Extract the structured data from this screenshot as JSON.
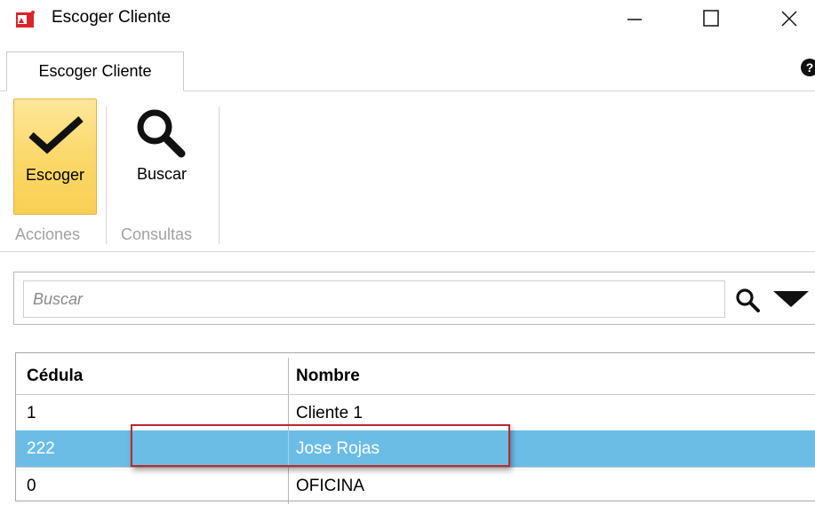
{
  "window": {
    "title": "Escoger Cliente"
  },
  "ribbon": {
    "tab_label": "Escoger Cliente",
    "groups": [
      {
        "label": "Acciones",
        "buttons": [
          {
            "label": "Escoger",
            "icon": "checkmark-icon",
            "active": true
          }
        ]
      },
      {
        "label": "Consultas",
        "buttons": [
          {
            "label": "Buscar",
            "icon": "search-icon",
            "active": false
          }
        ]
      }
    ]
  },
  "search": {
    "placeholder": "Buscar",
    "value": ""
  },
  "grid": {
    "columns": [
      "Cédula",
      "Nombre"
    ],
    "rows": [
      {
        "cedula": "1",
        "nombre": "Cliente 1",
        "selected": false
      },
      {
        "cedula": "222",
        "nombre": "Jose Rojas",
        "selected": true
      },
      {
        "cedula": "0",
        "nombre": "OFICINA",
        "selected": false
      }
    ]
  },
  "colors": {
    "selection": "#6bbde6",
    "active_button": "#fbd86a",
    "annotation": "#c1272d"
  }
}
